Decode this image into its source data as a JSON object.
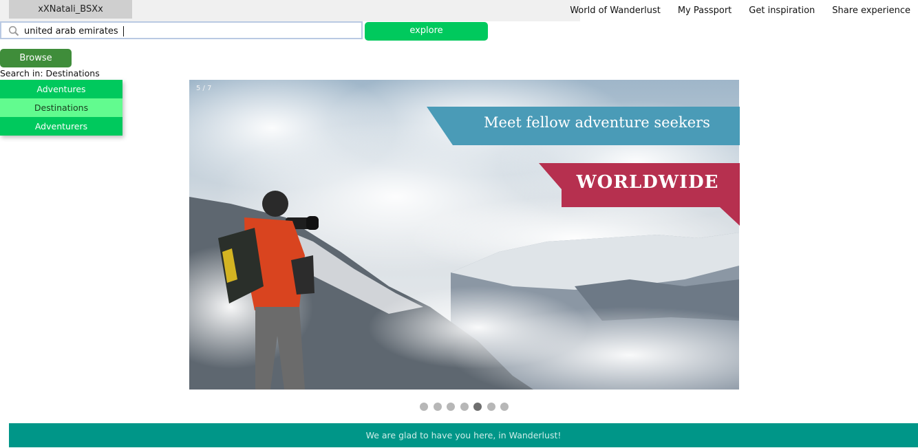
{
  "user": {
    "name": "xXNatali_BSXx"
  },
  "nav": {
    "items": [
      "World of Wanderlust",
      "My Passport",
      "Get inspiration",
      "Share experience"
    ]
  },
  "search": {
    "value": "united arab emirates",
    "explore_label": "explore"
  },
  "browse": {
    "label": "Browse",
    "search_in": "Search in: Destinations"
  },
  "dropdown": {
    "items": [
      "Adventures",
      "Destinations",
      "Adventurers"
    ],
    "selected": "Destinations"
  },
  "slider": {
    "counter": "5 / 7",
    "banner_top": "Meet fellow adventure seekers",
    "banner_bottom": "WORLDWIDE",
    "current": 5,
    "total": 7,
    "colors": {
      "banner_top": "#4a9bb7",
      "banner_bottom": "#b6304f"
    }
  },
  "footer": {
    "text": "We are glad to have you here, in Wanderlust!"
  },
  "colors": {
    "accent": "#00c95d",
    "browse": "#3f8d3a",
    "footer": "#009688",
    "dropdown_active": "#62fb8f"
  }
}
